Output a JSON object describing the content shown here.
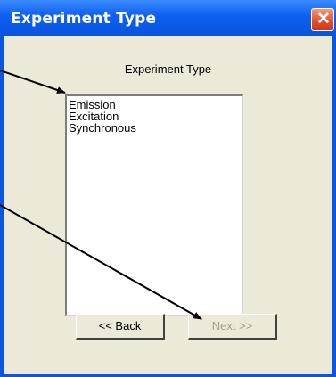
{
  "window": {
    "title": "Experiment Type",
    "close_glyph": "✕"
  },
  "dialog": {
    "heading": "Experiment Type",
    "list": {
      "items": [
        "Emission",
        "Excitation",
        "Synchronous"
      ]
    },
    "buttons": {
      "back_label": "<< Back",
      "next_label": "Next >>"
    }
  },
  "colors": {
    "titlebar": "#0a56e0",
    "client": "#ece9d8",
    "close": "#e2522f"
  }
}
